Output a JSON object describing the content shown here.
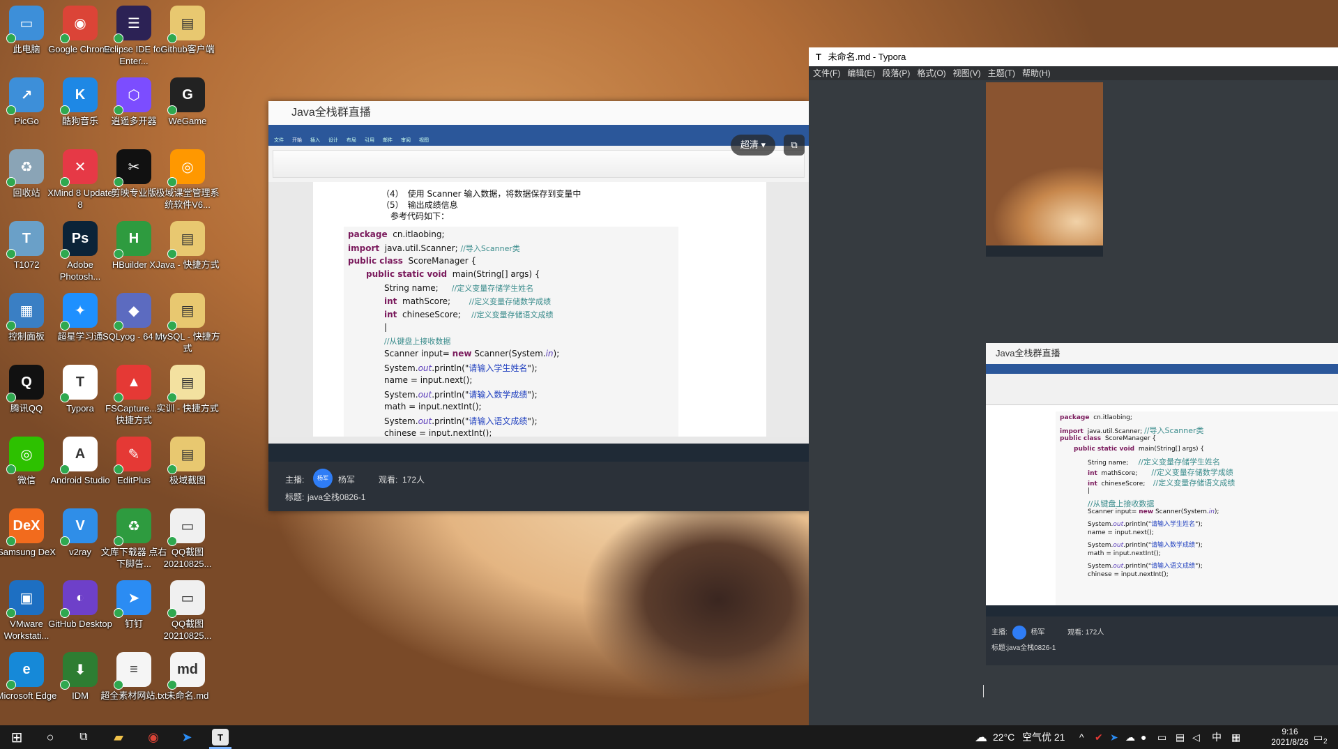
{
  "desktop_icons": [
    {
      "label": "此电脑",
      "col": 0,
      "row": 0,
      "color": "#3d8fd9",
      "glyph": "▭",
      "icon": "computer-icon"
    },
    {
      "label": "PicGo",
      "col": 0,
      "row": 1,
      "color": "#3d8fd9",
      "glyph": "↗",
      "icon": "picgo-icon"
    },
    {
      "label": "回收站",
      "col": 0,
      "row": 2,
      "color": "#8aa4b6",
      "glyph": "♻",
      "icon": "recycle-bin-icon"
    },
    {
      "label": "T1072",
      "col": 0,
      "row": 3,
      "color": "#6aa0c8",
      "glyph": "T",
      "icon": "t1072-icon"
    },
    {
      "label": "控制面板",
      "col": 0,
      "row": 4,
      "color": "#3a7fc4",
      "glyph": "▦",
      "icon": "control-panel-icon"
    },
    {
      "label": "腾讯QQ",
      "col": 0,
      "row": 5,
      "color": "#111111",
      "glyph": "Q",
      "icon": "qq-icon"
    },
    {
      "label": "微信",
      "col": 0,
      "row": 6,
      "color": "#2dc100",
      "glyph": "◎",
      "icon": "wechat-icon"
    },
    {
      "label": "Samsung DeX",
      "col": 0,
      "row": 7,
      "color": "#f26b1d",
      "glyph": "DeX",
      "icon": "dex-icon"
    },
    {
      "label": "VMware Workstati...",
      "col": 0,
      "row": 8,
      "color": "#1d6fc2",
      "glyph": "▣",
      "icon": "vmware-icon"
    },
    {
      "label": "Microsoft Edge",
      "col": 0,
      "row": 9,
      "color": "#1689d8",
      "glyph": "e",
      "icon": "edge-icon"
    },
    {
      "label": "Google Chrome",
      "col": 1,
      "row": 0,
      "color": "#db4437",
      "glyph": "◉",
      "icon": "chrome-icon"
    },
    {
      "label": "酷狗音乐",
      "col": 1,
      "row": 1,
      "color": "#1e88e5",
      "glyph": "K",
      "icon": "kugou-icon"
    },
    {
      "label": "XMind 8 Update 8",
      "col": 1,
      "row": 2,
      "color": "#e63946",
      "glyph": "✕",
      "icon": "xmind-icon"
    },
    {
      "label": "Adobe Photosh...",
      "col": 1,
      "row": 3,
      "color": "#0b2338",
      "glyph": "Ps",
      "icon": "photoshop-icon"
    },
    {
      "label": "超星学习通",
      "col": 1,
      "row": 4,
      "color": "#1e90ff",
      "glyph": "✦",
      "icon": "chaoxing-icon"
    },
    {
      "label": "Typora",
      "col": 1,
      "row": 5,
      "color": "#ffffff",
      "glyph": "T",
      "icon": "typora-icon"
    },
    {
      "label": "Android Studio",
      "col": 1,
      "row": 6,
      "color": "#ffffff",
      "glyph": "A",
      "icon": "android-studio-icon"
    },
    {
      "label": "v2ray",
      "col": 1,
      "row": 7,
      "color": "#2f8ee8",
      "glyph": "V",
      "icon": "v2ray-icon"
    },
    {
      "label": "GitHub Desktop",
      "col": 1,
      "row": 8,
      "color": "#6e40c9",
      "glyph": "◐",
      "icon": "github-icon"
    },
    {
      "label": "IDM",
      "col": 1,
      "row": 9,
      "color": "#2e7d32",
      "glyph": "⬇",
      "icon": "idm-icon"
    },
    {
      "label": "Eclipse IDE for Enter...",
      "col": 2,
      "row": 0,
      "color": "#2c2255",
      "glyph": "☰",
      "icon": "eclipse-icon"
    },
    {
      "label": "逍遥多开器",
      "col": 2,
      "row": 1,
      "color": "#7c4dff",
      "glyph": "⬡",
      "icon": "xiaoyao-icon"
    },
    {
      "label": "剪映专业版",
      "col": 2,
      "row": 2,
      "color": "#111111",
      "glyph": "✂",
      "icon": "jianying-icon"
    },
    {
      "label": "HBuilder X",
      "col": 2,
      "row": 3,
      "color": "#2e9b3f",
      "glyph": "H",
      "icon": "hbuilder-icon"
    },
    {
      "label": "SQLyog - 64 bit",
      "col": 2,
      "row": 4,
      "color": "#5c6bc0",
      "glyph": "◆",
      "icon": "sqlyog-icon"
    },
    {
      "label": "FSCapture... - 快捷方式",
      "col": 2,
      "row": 5,
      "color": "#e53935",
      "glyph": "▲",
      "icon": "fscapture-icon"
    },
    {
      "label": "EditPlus",
      "col": 2,
      "row": 6,
      "color": "#e53935",
      "glyph": "✎",
      "icon": "editplus-icon"
    },
    {
      "label": "文库下载器 点右下脚告...",
      "col": 2,
      "row": 7,
      "color": "#2e9b3f",
      "glyph": "♻",
      "icon": "wenku-icon"
    },
    {
      "label": "钉钉",
      "col": 2,
      "row": 8,
      "color": "#2b8cf3",
      "glyph": "➤",
      "icon": "dingtalk-icon"
    },
    {
      "label": "超全素材网站.txt",
      "col": 2,
      "row": 9,
      "color": "#f5f5f5",
      "glyph": "≡",
      "icon": "txt-file-icon"
    },
    {
      "label": "Github客户端",
      "col": 3,
      "row": 0,
      "color": "#e8c870",
      "glyph": "▤",
      "icon": "folder-icon"
    },
    {
      "label": "WeGame",
      "col": 3,
      "row": 1,
      "color": "#222222",
      "glyph": "G",
      "icon": "wegame-icon"
    },
    {
      "label": "极域课堂管理系统软件V6...",
      "col": 3,
      "row": 2,
      "color": "#ff9800",
      "glyph": "◎",
      "icon": "jiyu-icon"
    },
    {
      "label": "Java - 快捷方式",
      "col": 3,
      "row": 3,
      "color": "#e8c870",
      "glyph": "▤",
      "icon": "folder-icon"
    },
    {
      "label": "MySQL - 快捷方式",
      "col": 3,
      "row": 4,
      "color": "#e8c870",
      "glyph": "▤",
      "icon": "folder-icon"
    },
    {
      "label": "实训 - 快捷方式",
      "col": 3,
      "row": 5,
      "color": "#f3e1a0",
      "glyph": "▤",
      "icon": "folder-icon"
    },
    {
      "label": "极域截图",
      "col": 3,
      "row": 6,
      "color": "#e8c870",
      "glyph": "▤",
      "icon": "folder-icon"
    },
    {
      "label": "QQ截图 20210825...",
      "col": 3,
      "row": 7,
      "color": "#f0f0f0",
      "glyph": "▭",
      "icon": "image-file-icon"
    },
    {
      "label": "QQ截图 20210825...",
      "col": 3,
      "row": 8,
      "color": "#f0f0f0",
      "glyph": "▭",
      "icon": "image-file-icon"
    },
    {
      "label": "未命名.md",
      "col": 3,
      "row": 9,
      "color": "#f5f5f5",
      "glyph": "md",
      "icon": "md-file-icon"
    }
  ],
  "live_window": {
    "title": "Java全栈群直播",
    "hd_label": "超清",
    "host_label": "主播:",
    "host_name": "杨军",
    "viewers_label": "观看:",
    "viewers": "172人",
    "subject_label": "标题:",
    "subject": "java全栈0826-1",
    "avatar_text": "杨军"
  },
  "doc": {
    "list": [
      "（4）　使用 Scanner 输入数据，将数据保存到变量中",
      "（5）　输出成绩信息"
    ],
    "intro": "参考代码如下：",
    "code": [
      {
        "i": 0,
        "t": [
          [
            "kw",
            "package"
          ],
          [
            "",
            "  cn.itlaobing;"
          ]
        ]
      },
      {
        "i": 0,
        "t": [
          [
            "kw",
            "import"
          ],
          [
            "",
            "  java.util.Scanner; "
          ],
          [
            "cm",
            "//导入Scanner类"
          ]
        ]
      },
      {
        "i": 0,
        "t": [
          [
            "kw",
            "public class"
          ],
          [
            "",
            "  ScoreManager {"
          ]
        ]
      },
      {
        "i": 1,
        "t": [
          [
            "kw",
            "public static void"
          ],
          [
            "",
            "  main(String[] args) {"
          ]
        ]
      },
      {
        "i": 2,
        "t": [
          [
            "",
            "String name;     "
          ],
          [
            "cm",
            "//定义变量存储学生姓名"
          ]
        ]
      },
      {
        "i": 2,
        "t": [
          [
            "kw",
            "int"
          ],
          [
            "",
            "  mathScore;       "
          ],
          [
            "cm",
            "//定义变量存储数学成绩"
          ]
        ]
      },
      {
        "i": 2,
        "t": [
          [
            "kw",
            "int"
          ],
          [
            "",
            "  chineseScore;    "
          ],
          [
            "cm",
            "//定义变量存储语文成绩"
          ]
        ]
      },
      {
        "i": 2,
        "t": [
          [
            "",
            "|"
          ]
        ]
      },
      {
        "i": 2,
        "t": [
          [
            "cm",
            "//从键盘上接收数据"
          ]
        ]
      },
      {
        "i": 2,
        "t": [
          [
            "",
            "Scanner input= "
          ],
          [
            "kw",
            "new"
          ],
          [
            "",
            " Scanner(System."
          ],
          [
            "it",
            "in"
          ],
          [
            "",
            ");"
          ]
        ]
      },
      {
        "i": 2,
        "t": [
          [
            "",
            "System."
          ],
          [
            "it",
            "out"
          ],
          [
            "",
            ".println(\""
          ],
          [
            "st",
            "请输入学生姓名"
          ],
          [
            "",
            "\");"
          ]
        ]
      },
      {
        "i": 2,
        "t": [
          [
            "",
            "name = input.next();"
          ]
        ]
      },
      {
        "i": 2,
        "t": [
          [
            "",
            "System."
          ],
          [
            "it",
            "out"
          ],
          [
            "",
            ".println(\""
          ],
          [
            "st",
            "请输入数学成绩"
          ],
          [
            "",
            "\");"
          ]
        ]
      },
      {
        "i": 2,
        "t": [
          [
            "",
            "math = input.nextInt();"
          ]
        ]
      },
      {
        "i": 2,
        "t": [
          [
            "",
            "System."
          ],
          [
            "it",
            "out"
          ],
          [
            "",
            ".println(\""
          ],
          [
            "st",
            "请输入语文成绩"
          ],
          [
            "",
            "\");"
          ]
        ]
      },
      {
        "i": 2,
        "t": [
          [
            "",
            "chinese = input.nextInt();"
          ]
        ]
      }
    ]
  },
  "typora": {
    "title": "未命名.md - Typora",
    "menu": [
      "文件(F)",
      "编辑(E)",
      "段落(P)",
      "格式(O)",
      "视图(V)",
      "主题(T)",
      "帮助(H)"
    ]
  },
  "thumb2_title": "Java全栈群直播",
  "taskbar": {
    "weather_temp": "22°C",
    "weather_aqi": "空气优 21",
    "ime": "中",
    "time": "9:16",
    "date": "2021/8/26",
    "notif_count": "2"
  }
}
